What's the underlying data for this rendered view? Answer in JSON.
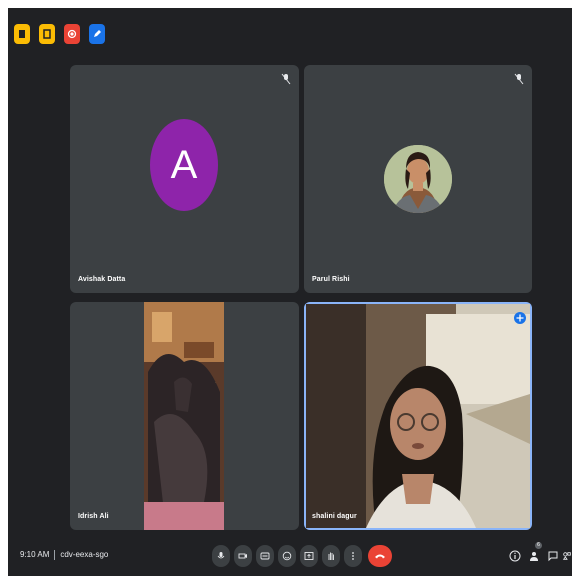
{
  "extensions": [
    {
      "name": "notes-extension",
      "color": "#fbbc04"
    },
    {
      "name": "attendance-extension",
      "color": "#fbbc04"
    },
    {
      "name": "record-extension",
      "color": "#ea4335"
    },
    {
      "name": "edit-extension",
      "color": "#1a73e8"
    }
  ],
  "participants": [
    {
      "name": "Avishak Datta",
      "initial": "A",
      "avatar_color": "#8e24aa",
      "muted": true
    },
    {
      "name": "Parul Rishi",
      "muted": true
    },
    {
      "name": "Idrish Ali"
    },
    {
      "name": "shalini dagur",
      "pinned": true
    }
  ],
  "meeting": {
    "time": "9:10 AM",
    "code": "cdv-eexa-sgo"
  },
  "controls": {
    "participants_count": "6"
  },
  "colors": {
    "background": "#202124",
    "tile": "#3c4043",
    "end_call": "#ea4335",
    "accent": "#8ab4f8"
  }
}
